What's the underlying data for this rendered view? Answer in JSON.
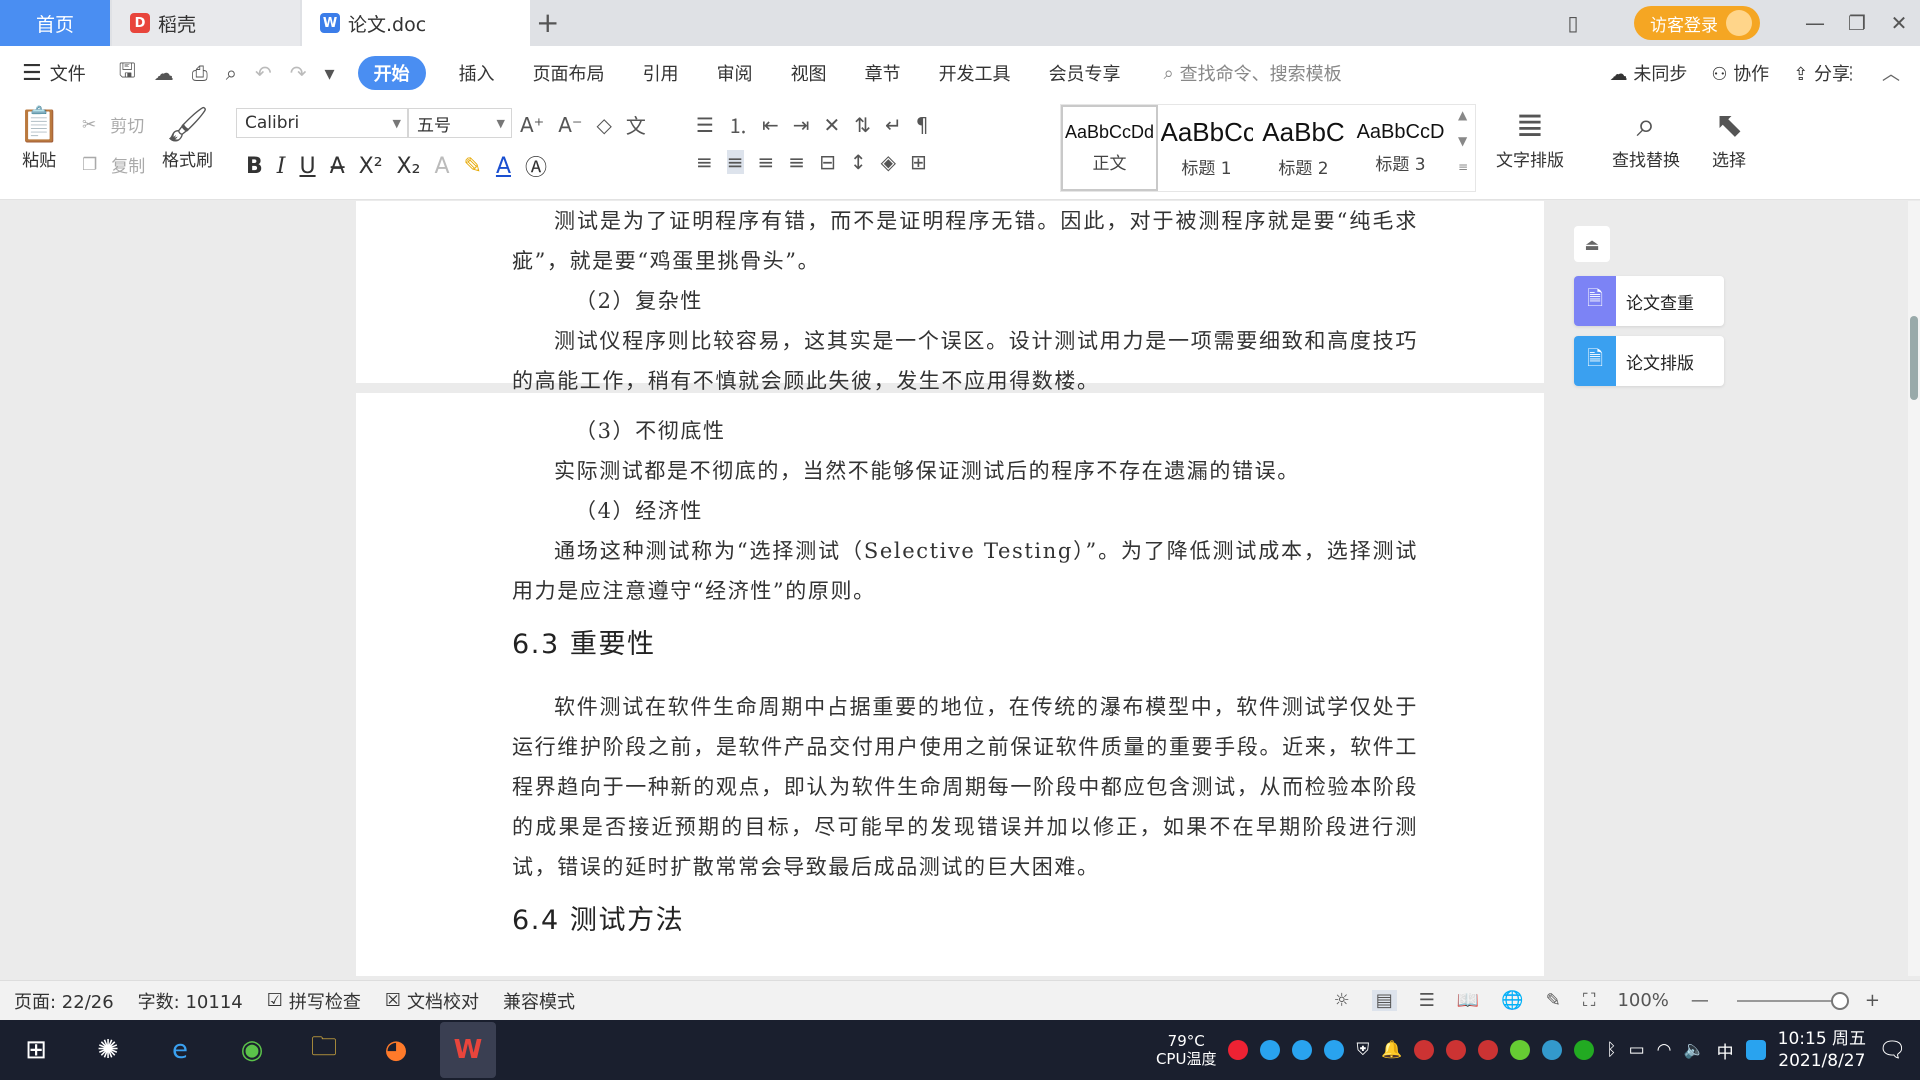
{
  "tabs": {
    "home": "首页",
    "daoke": "稻壳",
    "doc": "论文.doc",
    "add": "+"
  },
  "window": {
    "login": "访客登录"
  },
  "menu": {
    "file": "文件",
    "items": [
      "开始",
      "插入",
      "页面布局",
      "引用",
      "审阅",
      "视图",
      "章节",
      "开发工具",
      "会员专享"
    ],
    "search": "查找命令、搜索模板",
    "right": [
      "未同步",
      "协作",
      "分享"
    ]
  },
  "ribbon": {
    "paste": "粘贴",
    "cut": "剪切",
    "copy": "复制",
    "format_painter": "格式刷",
    "font_name": "Calibri",
    "font_size": "五号",
    "styles": [
      {
        "preview": "AaBbCcDd",
        "name": "正文"
      },
      {
        "preview": "AaBbCc",
        "name": "标题 1"
      },
      {
        "preview": "AaBbC",
        "name": "标题 2"
      },
      {
        "preview": "AaBbCcD",
        "name": "标题 3"
      }
    ],
    "text_layout": "文字排版",
    "find_replace": "查找替换",
    "select": "选择"
  },
  "document": {
    "para1": "测试是为了证明程序有错，而不是证明程序无错。因此，对于被测程序就是要“纯毛求疵”，就是要“鸡蛋里挑骨头”。",
    "h_2": "（2）复杂性",
    "para2": "测试仪程序则比较容易，这其实是一个误区。设计测试用力是一项需要细致和高度技巧的高能工作，稍有不慎就会顾此失彼，发生不应用得数楼。",
    "h_3": "（3）不彻底性",
    "para3": "实际测试都是不彻底的，当然不能够保证测试后的程序不存在遗漏的错误。",
    "h_4": "（4）经济性",
    "para4": "通场这种测试称为“选择测试（Selective Testing）”。为了降低测试成本，选择测试用力是应注意遵守“经济性”的原则。",
    "section_63": "6.3 重要性",
    "para5": "软件测试在软件生命周期中占据重要的地位，在传统的瀑布模型中，软件测试学仅处于运行维护阶段之前，是软件产品交付用户使用之前保证软件质量的重要手段。近来，软件工程界趋向于一种新的观点，即认为软件生命周期每一阶段中都应包含测试，从而检验本阶段的成果是否接近预期的目标，尽可能早的发现错误并加以修正，如果不在早期阶段进行测试，错误的延时扩散常常会导致最后成品测试的巨大困难。",
    "section_64": "6.4 测试方法"
  },
  "side_panel": {
    "check": "论文查重",
    "layout": "论文排版"
  },
  "status": {
    "page": "页面: 22/26",
    "words": "字数: 10114",
    "spell": "拼写检查",
    "proof": "文档校对",
    "compat": "兼容模式",
    "zoom": "100%"
  },
  "taskbar": {
    "cpu_temp": "79°C",
    "cpu_label": "CPU温度",
    "ime": "中",
    "time": "10:15 周五",
    "date": "2021/8/27"
  },
  "colors": {
    "accent": "#4a8ef2",
    "login": "#f5a623",
    "taskbar": "#1a1f2e"
  }
}
